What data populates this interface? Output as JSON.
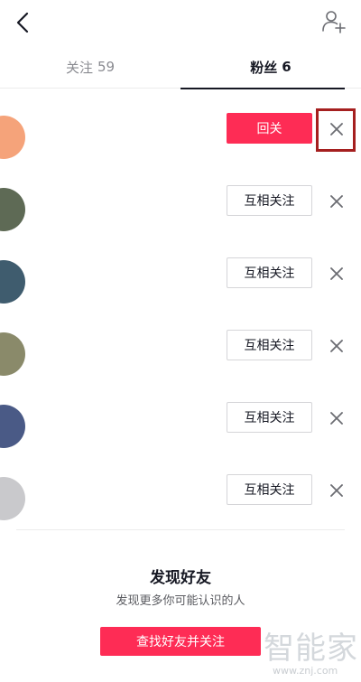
{
  "header": {
    "back_icon": "chevron-left-icon",
    "add_friend_icon": "add-user-icon"
  },
  "tabs": [
    {
      "label": "关注",
      "count": "59",
      "active": false
    },
    {
      "label": "粉丝",
      "count": "6",
      "active": true
    }
  ],
  "fans": [
    {
      "action_label": "回关",
      "style": "primary",
      "avatar_color": "#f5a37a"
    },
    {
      "action_label": "互相关注",
      "style": "secondary",
      "avatar_color": "#5e6a55"
    },
    {
      "action_label": "互相关注",
      "style": "secondary",
      "avatar_color": "#3f5c6e"
    },
    {
      "action_label": "互相关注",
      "style": "secondary",
      "avatar_color": "#8a8a6a"
    },
    {
      "action_label": "互相关注",
      "style": "secondary",
      "avatar_color": "#4a5a86"
    },
    {
      "action_label": "互相关注",
      "style": "secondary",
      "avatar_color": "#c9c9cc"
    }
  ],
  "discover": {
    "title": "发现好友",
    "subtitle": "发现更多你可能认识的人",
    "button_label": "查找好友并关注"
  },
  "watermark": {
    "text": "智能家",
    "url": "www.znj.com"
  },
  "colors": {
    "accent": "#fe2c55",
    "highlight": "#a51f1f"
  }
}
